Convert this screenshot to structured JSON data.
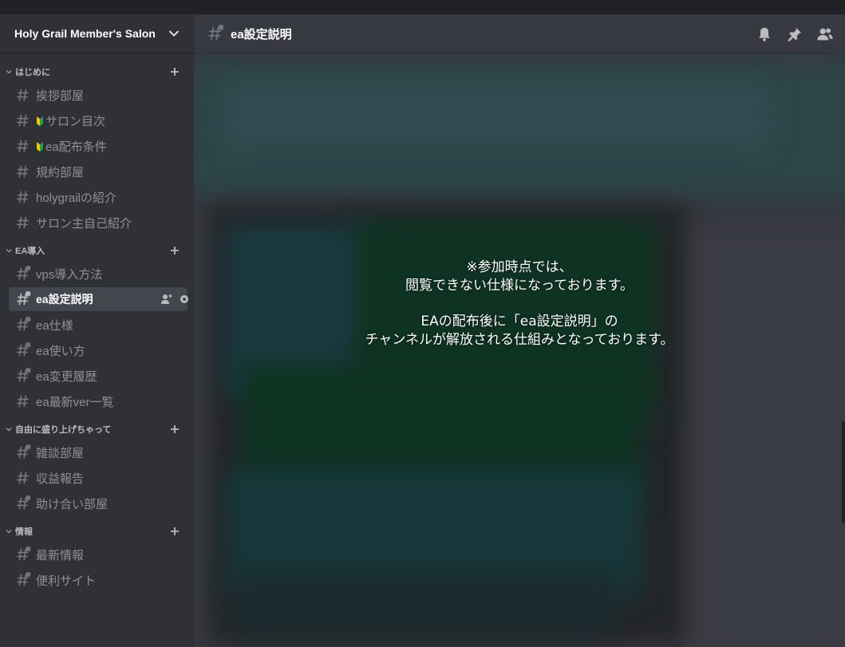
{
  "server": {
    "name": "Holy Grail Member's Salon"
  },
  "categories": [
    {
      "label": "はじめに",
      "channels": [
        {
          "name": "挨拶部屋",
          "leaf": false,
          "locked": false
        },
        {
          "name": "サロン目次",
          "leaf": true,
          "locked": false
        },
        {
          "name": "ea配布条件",
          "leaf": true,
          "locked": false
        },
        {
          "name": "規約部屋",
          "leaf": false,
          "locked": false
        },
        {
          "name": "holygrailの紹介",
          "leaf": false,
          "locked": false
        },
        {
          "name": "サロン主自己紹介",
          "leaf": false,
          "locked": false
        }
      ]
    },
    {
      "label": "EA導入",
      "channels": [
        {
          "name": "vps導入方法",
          "leaf": false,
          "locked": true
        },
        {
          "name": "ea設定説明",
          "leaf": false,
          "locked": true,
          "selected": true
        },
        {
          "name": "ea仕様",
          "leaf": false,
          "locked": true
        },
        {
          "name": "ea使い方",
          "leaf": false,
          "locked": true
        },
        {
          "name": "ea変更履歴",
          "leaf": false,
          "locked": true
        },
        {
          "name": "ea最新ver一覧",
          "leaf": false,
          "locked": false
        }
      ]
    },
    {
      "label": "自由に盛り上げちゃって",
      "channels": [
        {
          "name": "雑談部屋",
          "leaf": false,
          "locked": true
        },
        {
          "name": "収益報告",
          "leaf": false,
          "locked": false
        },
        {
          "name": "助け合い部屋",
          "leaf": false,
          "locked": true
        }
      ]
    },
    {
      "label": "情報",
      "channels": [
        {
          "name": "最新情報",
          "leaf": false,
          "locked": true
        },
        {
          "name": "便利サイト",
          "leaf": false,
          "locked": true
        }
      ]
    }
  ],
  "topbar": {
    "channel_name": "ea設定説明",
    "icons": [
      "bell-icon",
      "pin-icon",
      "members-icon"
    ]
  },
  "notice": {
    "lines_1": [
      "※参加時点では、",
      "閲覧できない仕様になっております。"
    ],
    "lines_2": [
      "EAの配布後に「ea設定説明」の",
      "チャンネルが解放される仕組みとなっております。"
    ]
  },
  "colors": {
    "sidebar_bg": "#2f3136",
    "main_bg": "#36393f",
    "selected_bg": "#42464d",
    "channel_text": "#8e9297",
    "category_text": "#b9bbbe"
  }
}
